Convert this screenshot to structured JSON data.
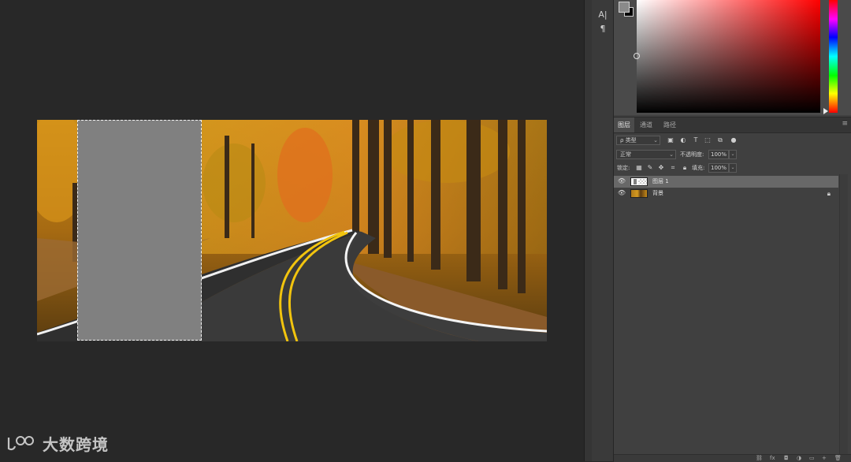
{
  "canvas": {
    "watermark_text": "大数跨境",
    "watermark_logo": "大数跨境"
  },
  "toolbar": {
    "text_tool_glyph": "A|",
    "paragraph_glyph": "¶"
  },
  "color_panel": {
    "foreground_color": "#8a8a8a",
    "background_color": "#000000",
    "picker_hue": "#ff0000"
  },
  "layers_panel": {
    "tabs": [
      {
        "label": "图层",
        "active": true
      },
      {
        "label": "通道",
        "active": false
      },
      {
        "label": "路径",
        "active": false
      }
    ],
    "menu_icon": "≡",
    "filter": {
      "search_glyph": "ρ",
      "label": "类型"
    },
    "filter_icons": [
      "image-filter-icon",
      "adjustment-filter-icon",
      "type-filter-icon",
      "shape-filter-icon",
      "smart-object-filter-icon",
      "toggle-filter-icon"
    ],
    "blend_mode": "正常",
    "opacity_label": "不透明度:",
    "opacity_value": "100%",
    "lock_label": "锁定:",
    "fill_label": "填充:",
    "fill_value": "100%",
    "layers": [
      {
        "name": "图层 1",
        "selected": true,
        "visible": true,
        "locked": false
      },
      {
        "name": "背景",
        "selected": false,
        "visible": true,
        "locked": true
      }
    ]
  }
}
